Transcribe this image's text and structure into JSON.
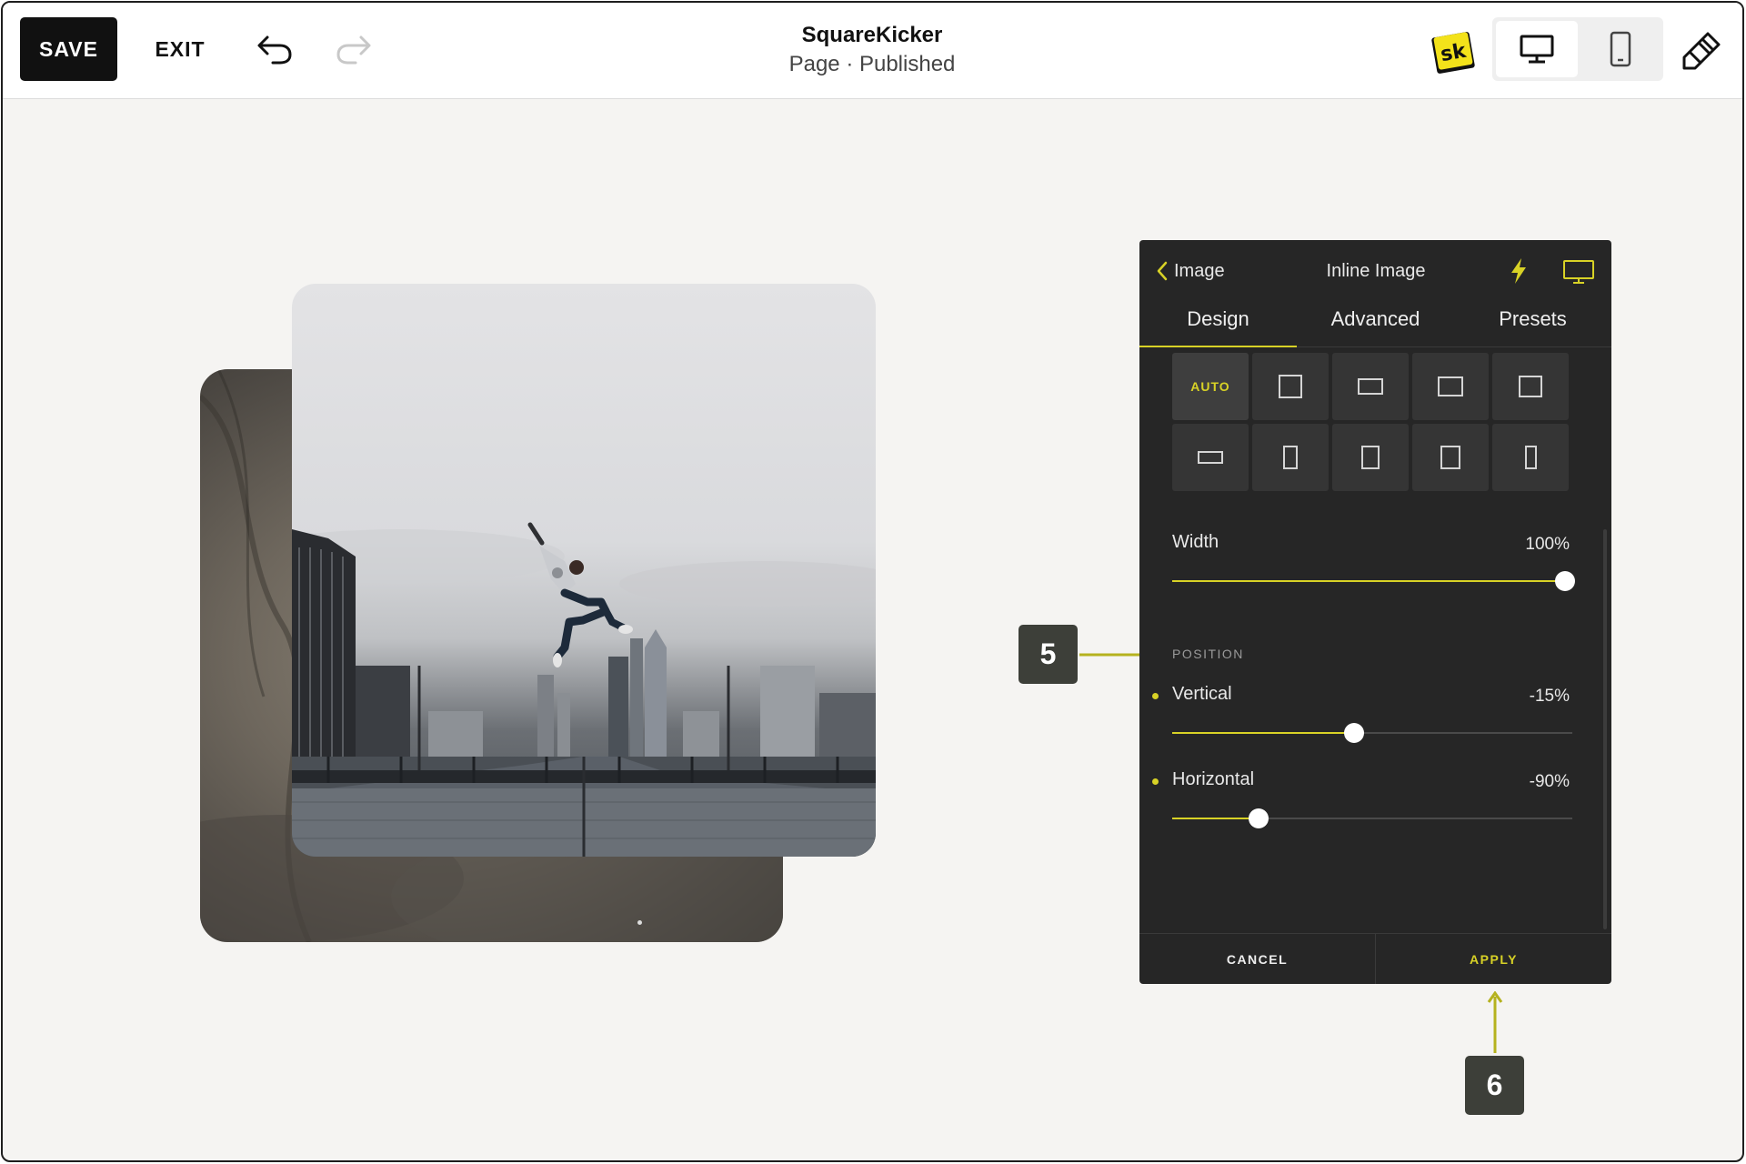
{
  "colors": {
    "accent": "#d8d226",
    "panel_bg": "#262626",
    "canvas_bg": "#f5f4f2",
    "callout_bg": "#3d3f39"
  },
  "topbar": {
    "save_label": "SAVE",
    "exit_label": "EXIT",
    "undo_icon": "undo-icon",
    "redo_icon": "redo-icon",
    "site_title": "SquareKicker",
    "page_status": "Page · Published",
    "logo_text": "sk",
    "device_options": [
      "desktop",
      "mobile"
    ],
    "selected_device": "desktop",
    "style_icon": "paintbrush-icon"
  },
  "panel": {
    "back_label": "Image",
    "title": "Inline Image",
    "tabs": [
      {
        "label": "Design",
        "active": true
      },
      {
        "label": "Advanced",
        "active": false
      },
      {
        "label": "Presets",
        "active": false
      }
    ],
    "aspect_ratios": {
      "auto_label": "AUTO",
      "options": [
        "auto",
        "square",
        "landscape",
        "landscape",
        "square",
        "wide",
        "portrait",
        "portrait",
        "portrait",
        "tall"
      ],
      "selected": "auto"
    },
    "width": {
      "label": "Width",
      "value": "100%",
      "fraction": 1.0
    },
    "position_heading": "POSITION",
    "vertical": {
      "label": "Vertical",
      "value": "-15%",
      "fraction": 0.455
    },
    "horizontal": {
      "label": "Horizontal",
      "value": "-90%",
      "fraction": 0.215
    },
    "cancel_label": "CANCEL",
    "apply_label": "APPLY"
  },
  "callouts": [
    {
      "number": "5"
    },
    {
      "number": "6"
    }
  ]
}
